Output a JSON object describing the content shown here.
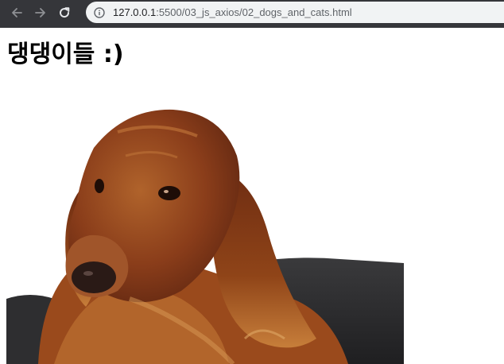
{
  "browser": {
    "url_host": "127.0.0.1",
    "url_path": ":5500/03_js_axios/02_dogs_and_cats.html"
  },
  "page": {
    "title": "댕댕이들 :)"
  },
  "image": {
    "subject": "dog",
    "icon": "dog-photo"
  },
  "colors": {
    "chrome_dark": "#35363a",
    "address_bg": "#f1f3f4",
    "fur_main": "#8a3d1a",
    "fur_light": "#b0632b",
    "sofa": "#2b2b2d"
  }
}
